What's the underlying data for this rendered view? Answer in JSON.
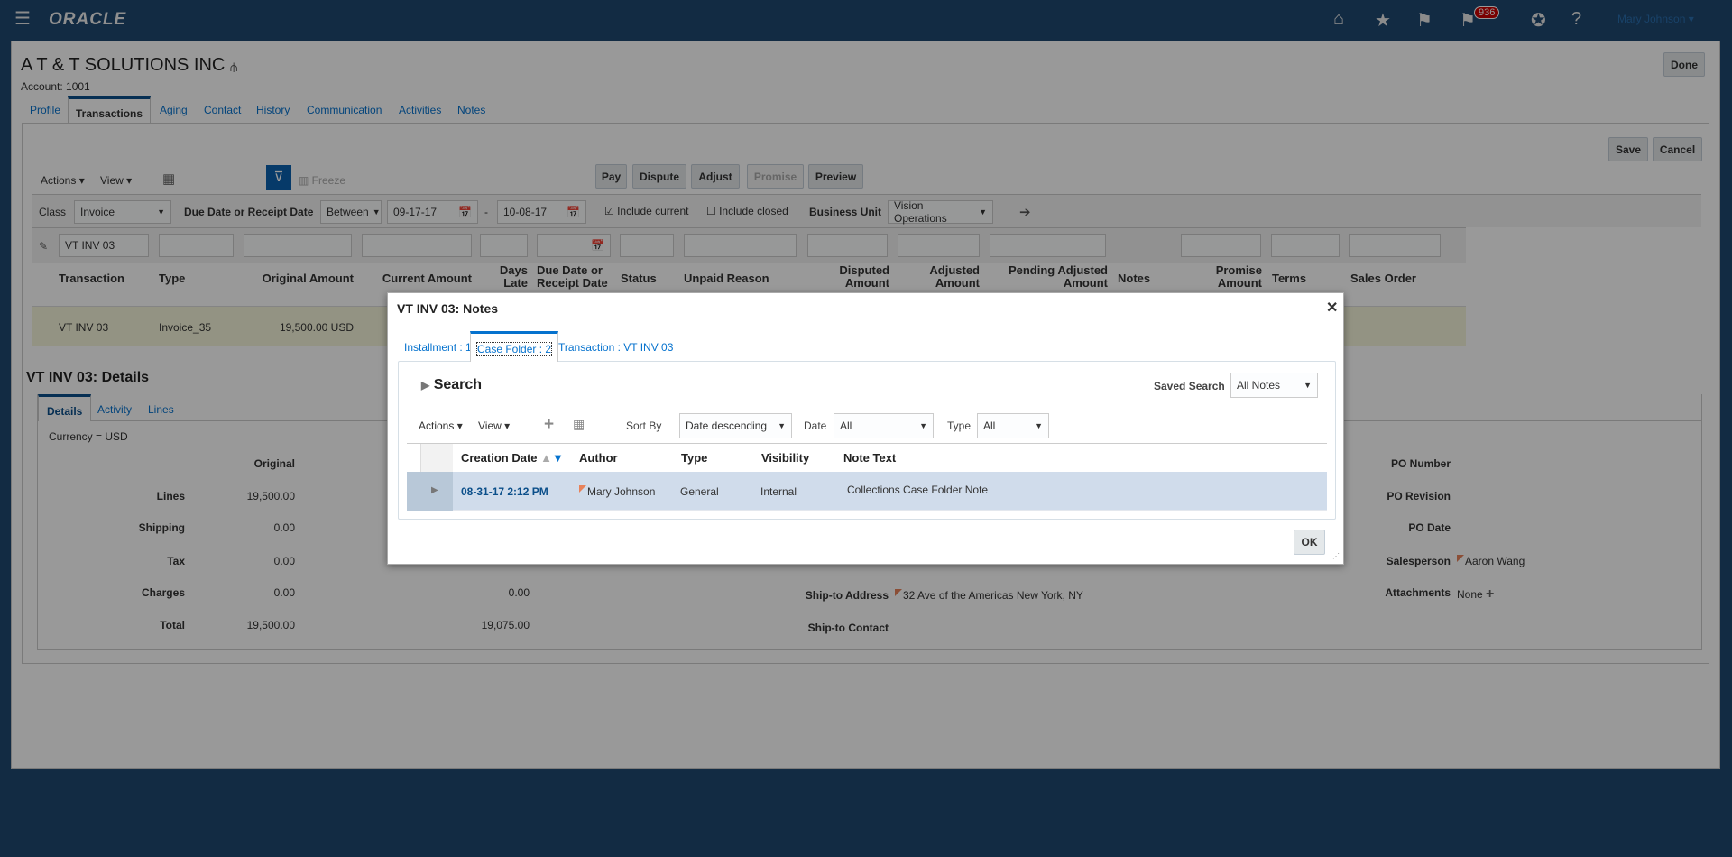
{
  "header": {
    "logo": "ORACLE",
    "notification_count": "936",
    "user": "Mary Johnson",
    "icons": [
      "menu-icon",
      "home-icon",
      "star-icon",
      "flag-icon",
      "notifications-icon",
      "accessibility-icon",
      "help-icon"
    ]
  },
  "customer": {
    "name": "A T & T SOLUTIONS INC",
    "account": "Account: 1001",
    "done": "Done"
  },
  "tabs": [
    "Profile",
    "Transactions",
    "Aging",
    "Contact",
    "History",
    "Communication",
    "Activities",
    "Notes"
  ],
  "toolbar": {
    "save": "Save",
    "cancel": "Cancel",
    "actions": "Actions",
    "view": "View",
    "freeze": "Freeze",
    "pay": "Pay",
    "dispute": "Dispute",
    "adjust": "Adjust",
    "promise": "Promise",
    "preview": "Preview"
  },
  "filters": {
    "class_label": "Class",
    "class_value": "Invoice",
    "due_label": "Due Date or Receipt Date",
    "operator": "Between",
    "from": "09-17-17",
    "dash": "-",
    "to": "10-08-17",
    "include_current": "Include current",
    "include_closed": "Include closed",
    "bu_label": "Business Unit",
    "bu_value": "Vision Operations",
    "qbe_transaction": "VT INV 03"
  },
  "columns": [
    "Transaction",
    "Type",
    "Original Amount",
    "Current Amount",
    "Days Late",
    "Due Date or Receipt Date",
    "Status",
    "Unpaid Reason",
    "Disputed Amount",
    "Adjusted Amount",
    "Pending Adjusted Amount",
    "Notes",
    "Promise Amount",
    "Terms",
    "Sales Order"
  ],
  "row": {
    "transaction": "VT INV 03",
    "type": "Invoice_35",
    "original": "19,500.00 USD"
  },
  "details": {
    "title": "VT INV 03: Details",
    "tabs": [
      "Details",
      "Activity",
      "Lines"
    ],
    "currency": "Currency =  USD",
    "original_header": "Original",
    "rows": [
      {
        "label": "Lines",
        "original": "19,500.00",
        "other": ""
      },
      {
        "label": "Shipping",
        "original": "0.00",
        "other": ""
      },
      {
        "label": "Tax",
        "original": "0.00",
        "other": ""
      },
      {
        "label": "Charges",
        "original": "0.00",
        "other": "0.00"
      },
      {
        "label": "Total",
        "original": "19,500.00",
        "other": "19,075.00"
      }
    ],
    "ship_to_address_label": "Ship-to Address",
    "ship_to_address": "32 Ave of the Americas New York, NY",
    "ship_to_contact_label": "Ship-to Contact",
    "right": [
      {
        "label": "PO Number",
        "value": ""
      },
      {
        "label": "PO Revision",
        "value": ""
      },
      {
        "label": "PO Date",
        "value": ""
      },
      {
        "label": "Salesperson",
        "value": "Aaron Wang"
      },
      {
        "label": "Attachments",
        "value": "None"
      }
    ]
  },
  "modal": {
    "title": "VT INV 03: Notes",
    "tabs": [
      "Installment : 1",
      "Case Folder : 2",
      "Transaction : VT INV 03"
    ],
    "search": "Search",
    "saved_search_label": "Saved Search",
    "saved_search": "All Notes",
    "actions": "Actions",
    "view": "View",
    "sort_label": "Sort By",
    "sort_value": "Date descending",
    "date_label": "Date",
    "date_value": "All",
    "type_label": "Type",
    "type_value": "All",
    "columns": [
      "Creation Date",
      "Author",
      "Type",
      "Visibility",
      "Note Text"
    ],
    "notes": [
      {
        "date": "08-31-17 2:12 PM",
        "author": "Mary Johnson",
        "type": "General",
        "visibility": "Internal",
        "text": "Collections Case Folder Note"
      }
    ],
    "ok": "OK"
  }
}
